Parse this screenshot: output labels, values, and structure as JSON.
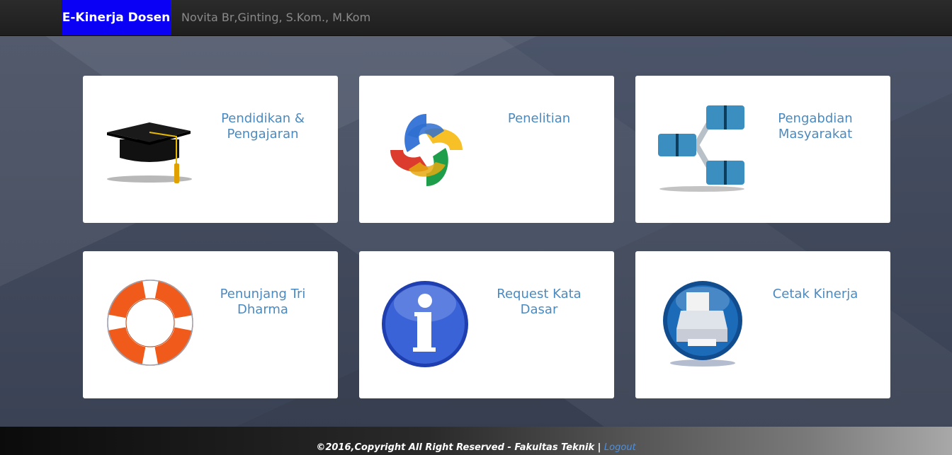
{
  "navbar": {
    "brand": "E-Kinerja Dosen",
    "user_name": "Novita Br,Ginting, S.Kom., M.Kom"
  },
  "menu": {
    "items": [
      {
        "title": "Pendidikan &\nPengajaran",
        "icon": "graduation-cap-icon"
      },
      {
        "title": "Penelitian",
        "icon": "research-rings-icon"
      },
      {
        "title": "Pengabdian\nMasyarakat",
        "icon": "network-diagram-icon"
      },
      {
        "title": "Penunjang Tri\nDharma",
        "icon": "lifebuoy-icon"
      },
      {
        "title": "Request Kata\nDasar",
        "icon": "info-icon"
      },
      {
        "title": "Cetak Kinerja",
        "icon": "printer-icon"
      }
    ]
  },
  "footer": {
    "copyright": "©2016,Copyright All Right Reserved - Fakultas Teknik",
    "separator": "|",
    "logout": "Logout"
  },
  "colors": {
    "brand_bg": "#0a00f5",
    "title_blue": "#4a8ac0",
    "link_blue": "#4a90e2"
  }
}
